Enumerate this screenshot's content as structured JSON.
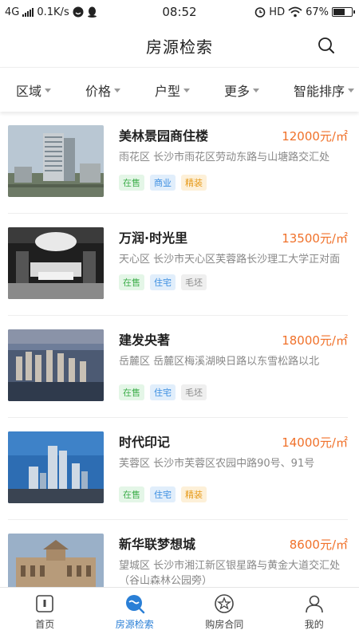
{
  "status_bar": {
    "network": "4G",
    "speed": "0.1K/s",
    "time": "08:52",
    "hd": "HD",
    "battery": "67%",
    "battery_level": 0.67
  },
  "header": {
    "title": "房源检索"
  },
  "filters": [
    {
      "label": "区域"
    },
    {
      "label": "价格"
    },
    {
      "label": "户型"
    },
    {
      "label": "更多"
    },
    {
      "label": "智能排序"
    }
  ],
  "listings": [
    {
      "name": "美林景园商住楼",
      "price": "12000元/㎡",
      "address": "雨花区  长沙市雨花区劳动东路与山塘路交汇处",
      "tags": [
        {
          "text": "在售",
          "style": "green"
        },
        {
          "text": "商业",
          "style": "blue"
        },
        {
          "text": "精装",
          "style": "orange"
        }
      ],
      "image": "tower-city-photo"
    },
    {
      "name": "万润·时光里",
      "price": "13500元/㎡",
      "address": "天心区  长沙市天心区芙蓉路长沙理工大学正对面",
      "tags": [
        {
          "text": "在售",
          "style": "green"
        },
        {
          "text": "住宅",
          "style": "blue"
        },
        {
          "text": "毛坯",
          "style": "gray"
        }
      ],
      "image": "lobby-interior-photo"
    },
    {
      "name": "建发央著",
      "price": "18000元/㎡",
      "address": "岳麓区  岳麓区梅溪湖映日路以东雪松路以北",
      "tags": [
        {
          "text": "在售",
          "style": "green"
        },
        {
          "text": "住宅",
          "style": "blue"
        },
        {
          "text": "毛坯",
          "style": "gray"
        }
      ],
      "image": "aerial-city-photo"
    },
    {
      "name": "时代印记",
      "price": "14000元/㎡",
      "address": "芙蓉区  长沙市芙蓉区农园中路90号、91号",
      "tags": [
        {
          "text": "在售",
          "style": "green"
        },
        {
          "text": "住宅",
          "style": "blue"
        },
        {
          "text": "精装",
          "style": "orange"
        }
      ],
      "image": "highrise-blue-sky-photo"
    },
    {
      "name": "新华联梦想城",
      "price": "8600元/㎡",
      "address": "望城区  长沙市湘江新区银星路与黄金大道交汇处（谷山森林公园旁）",
      "tags": [],
      "image": "classical-building-photo"
    }
  ],
  "tabbar": [
    {
      "label": "首页",
      "icon": "home-icon",
      "active": false
    },
    {
      "label": "房源检索",
      "icon": "search-house-icon",
      "active": true
    },
    {
      "label": "购房合同",
      "icon": "star-circle-icon",
      "active": false
    },
    {
      "label": "我的",
      "icon": "user-icon",
      "active": false
    }
  ],
  "colors": {
    "accent": "#2a7fd6",
    "price": "#f0712a"
  }
}
